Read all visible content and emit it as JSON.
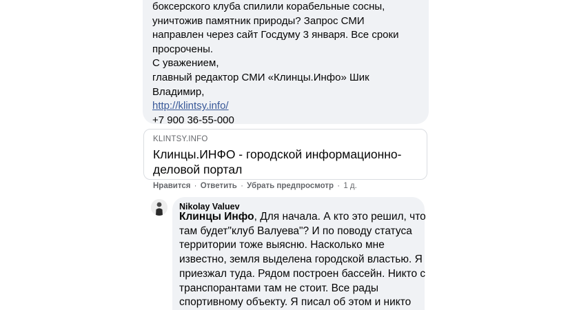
{
  "top_comment": {
    "lines": [
      "боксерского клуба спилили корабельные сосны,",
      "уничтожив памятник природы? Запрос СМИ",
      "направлен через сайт Госдуму 3 января. Все сроки",
      "просрочены.",
      "С уважением,",
      "главный редактор СМИ «Клинцы.Инфо» Шик",
      "Владимир,"
    ],
    "link": "http://klintsy.info/",
    "phone": "+7 900 36-55-000"
  },
  "link_preview": {
    "domain": "KLINTSY.INFO",
    "title_line1": "Клинцы.ИНФО - городской информационно-",
    "title_line2": "деловой портал"
  },
  "actions": {
    "like": "Нравится",
    "reply": "Ответить",
    "remove_preview": "Убрать предпросмотр",
    "separator": "·",
    "time": "1 д."
  },
  "reply": {
    "author": "Nikolay Valuev",
    "mention": "Клинцы Инфо",
    "first_line_rest": ", Для начала. А кто это решил, что",
    "lines": [
      "там будет\"клуб Валуева\"? И по поводу статуса",
      "территории тоже выясню. Насколько мне",
      "известно, земля выделена городской властью. Я",
      "приезжал туда. Рядом построен бассейн. Никто с",
      "транспорантами там не стоит. Все рады",
      "спортивному объекту. Я писал об этом и никто"
    ]
  }
}
